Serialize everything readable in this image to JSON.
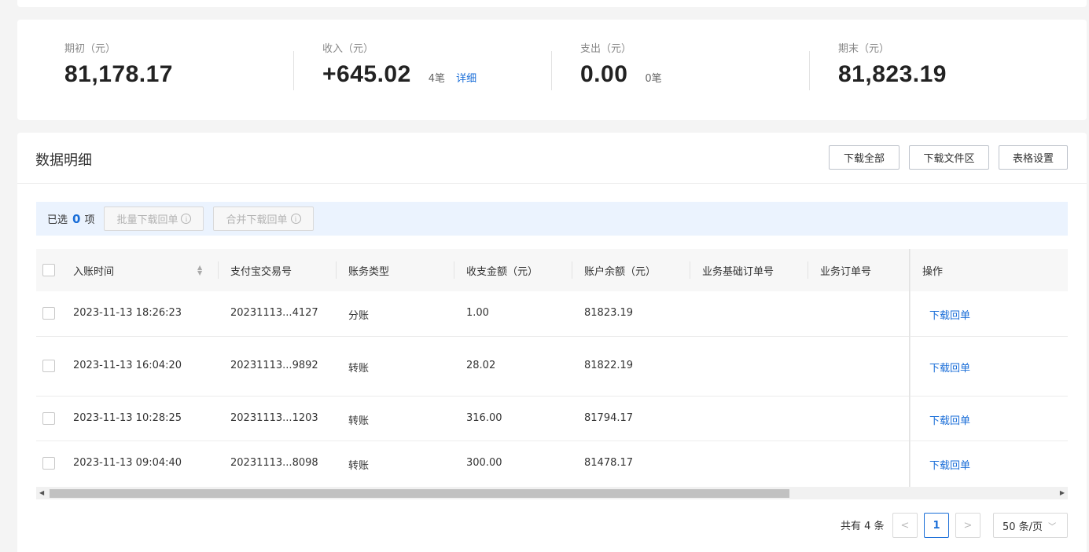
{
  "summary": {
    "opening": {
      "label": "期初（元）",
      "value": "81,178.17"
    },
    "income": {
      "label": "收入（元）",
      "value": "+645.02",
      "count": "4笔",
      "detail_link": "详细"
    },
    "expense": {
      "label": "支出（元）",
      "value": "0.00",
      "count": "0笔"
    },
    "closing": {
      "label": "期末（元）",
      "value": "81,823.19"
    }
  },
  "detail": {
    "title": "数据明细",
    "buttons": {
      "download_all": "下载全部",
      "download_area": "下载文件区",
      "table_settings": "表格设置"
    }
  },
  "selection": {
    "prefix": "已选",
    "count": "0",
    "suffix": "项",
    "batch_download": "批量下载回单",
    "merge_download": "合并下载回单"
  },
  "table": {
    "columns": [
      "入账时间",
      "支付宝交易号",
      "账务类型",
      "收支金额（元）",
      "账户余额（元）",
      "业务基础订单号",
      "业务订单号",
      "操作"
    ],
    "rows": [
      {
        "time": "2023-11-13 18:26:23",
        "txn": "20231113...4127",
        "type": "分账",
        "amount": "1.00",
        "balance": "81823.19",
        "action": "下载回单"
      },
      {
        "time": "2023-11-13 16:04:20",
        "txn": "20231113...9892",
        "type": "转账",
        "amount": "28.02",
        "balance": "81822.19",
        "action": "下载回单"
      },
      {
        "time": "2023-11-13 10:28:25",
        "txn": "20231113...1203",
        "type": "转账",
        "amount": "316.00",
        "balance": "81794.17",
        "action": "下载回单"
      },
      {
        "time": "2023-11-13 09:04:40",
        "txn": "20231113...8098",
        "type": "转账",
        "amount": "300.00",
        "balance": "81478.17",
        "action": "下载回单"
      }
    ]
  },
  "pagination": {
    "total": "共有 4 条",
    "current": "1",
    "page_size": "50 条/页"
  },
  "colors": {
    "accent": "#1a6ed8",
    "selection_bg": "#ebf3fe"
  }
}
